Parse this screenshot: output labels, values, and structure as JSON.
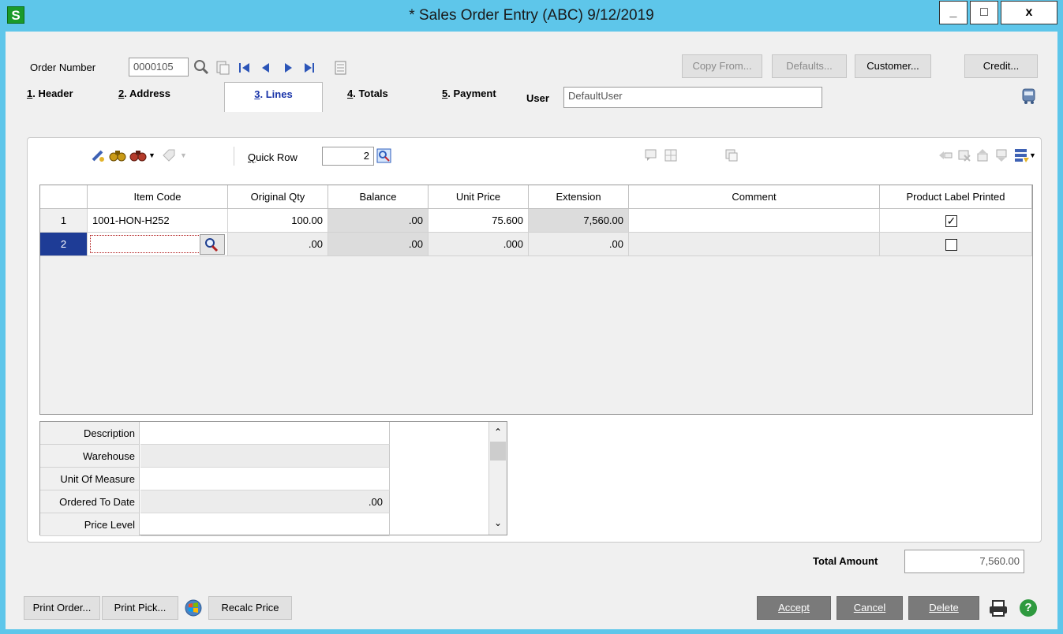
{
  "window": {
    "title": "* Sales Order Entry (ABC) 9/12/2019",
    "app_icon": "S",
    "min": "_",
    "max": "□",
    "close": "x"
  },
  "header": {
    "order_number_label": "Order Number",
    "order_number_value": "0000105",
    "user_label": "User",
    "user_value": "DefaultUser",
    "copy_from": "Copy From...",
    "defaults": "Defaults...",
    "customer": "Customer...",
    "credit": "Credit..."
  },
  "tabs": [
    {
      "num": "1",
      "label": ". Header"
    },
    {
      "num": "2",
      "label": ". Address"
    },
    {
      "num": "3",
      "label": ". Lines"
    },
    {
      "num": "4",
      "label": ". Totals"
    },
    {
      "num": "5",
      "label": ". Payment"
    }
  ],
  "lines_toolbar": {
    "quick_row_label": "Quick Row",
    "quick_row_value": "2"
  },
  "grid": {
    "columns": [
      "Item Code",
      "Original Qty",
      "Balance",
      "Unit Price",
      "Extension",
      "Comment",
      "Product Label Printed"
    ],
    "rows": [
      {
        "num": "1",
        "item_code": "1001-HON-H252",
        "original_qty": "100.00",
        "balance": ".00",
        "unit_price": "75.600",
        "extension": "7,560.00",
        "comment": "",
        "label_printed": true
      },
      {
        "num": "2",
        "item_code": "",
        "original_qty": ".00",
        "balance": ".00",
        "unit_price": ".000",
        "extension": ".00",
        "comment": "",
        "label_printed": false
      }
    ]
  },
  "detail": {
    "rows": [
      {
        "label": "Description",
        "value": ""
      },
      {
        "label": "Warehouse",
        "value": ""
      },
      {
        "label": "Unit Of Measure",
        "value": ""
      },
      {
        "label": "Ordered To Date",
        "value": ".00"
      },
      {
        "label": "Price Level",
        "value": ""
      }
    ]
  },
  "totals": {
    "total_amount_label": "Total Amount",
    "total_amount_value": "7,560.00"
  },
  "footer": {
    "print_order": "Print Order...",
    "print_pick": "Print Pick...",
    "recalc_price": "Recalc Price",
    "accept": "Accept",
    "cancel": "Cancel",
    "delete": "Delete"
  },
  "icons": {
    "check": "✓",
    "help": "?",
    "scroll_up": "⌃",
    "scroll_down": "⌄"
  }
}
